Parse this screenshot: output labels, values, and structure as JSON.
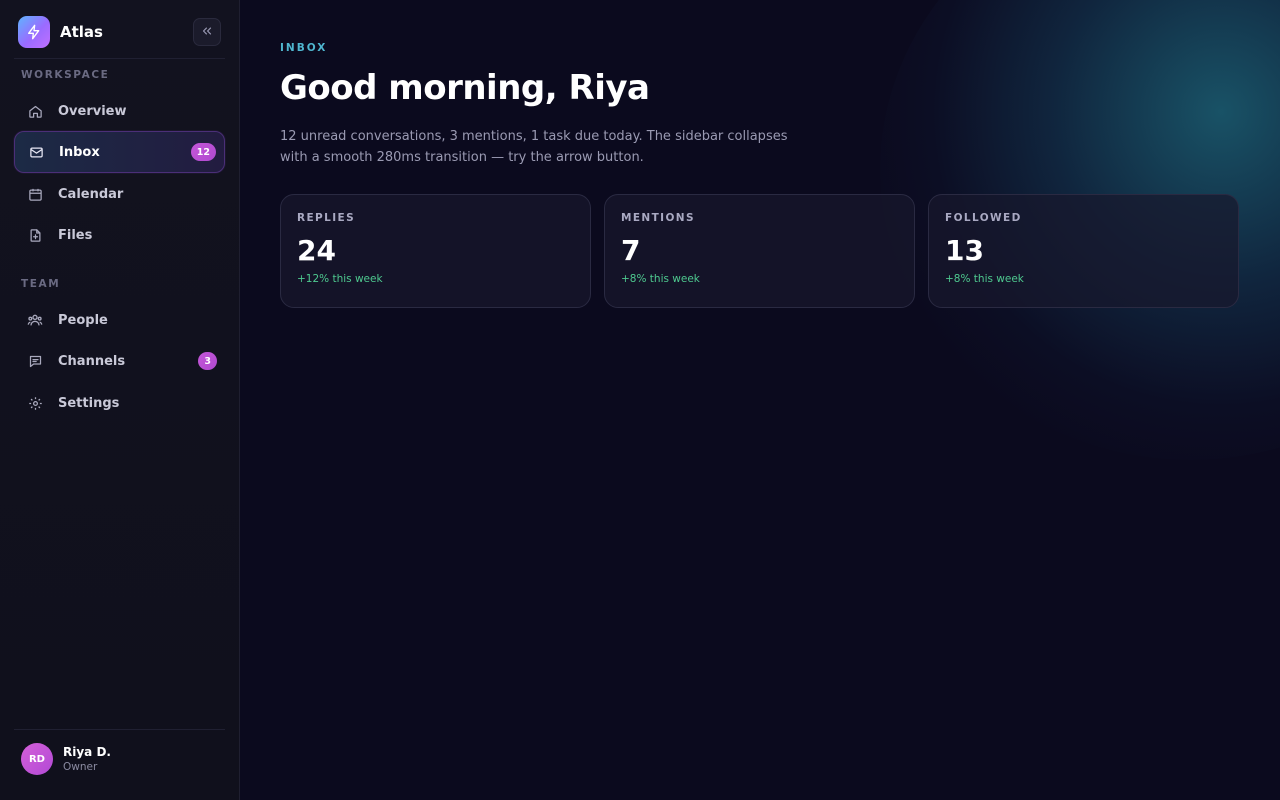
{
  "app": {
    "name": "Atlas"
  },
  "sidebar": {
    "sections": [
      {
        "label": "WORKSPACE"
      },
      {
        "label": "TEAM"
      }
    ],
    "items": [
      {
        "label": "Overview",
        "icon": "home-icon"
      },
      {
        "label": "Inbox",
        "icon": "mail-icon",
        "badge": "12",
        "active": true
      },
      {
        "label": "Calendar",
        "icon": "calendar-icon"
      },
      {
        "label": "Files",
        "icon": "file-plus-icon"
      },
      {
        "label": "People",
        "icon": "people-icon"
      },
      {
        "label": "Channels",
        "icon": "chat-icon",
        "badge": "3"
      },
      {
        "label": "Settings",
        "icon": "gear-icon"
      }
    ],
    "user": {
      "initials": "RD",
      "name": "Riya D.",
      "role": "Owner"
    }
  },
  "main": {
    "eyebrow": "INBOX",
    "title": "Good morning, Riya",
    "subtitle": "12 unread conversations, 3 mentions, 1 task due today. The sidebar collapses with a smooth 280ms transition — try the arrow button.",
    "cards": [
      {
        "label": "REPLIES",
        "value": "24",
        "delta": "+12% this week"
      },
      {
        "label": "MENTIONS",
        "value": "7",
        "delta": "+8% this week"
      },
      {
        "label": "FOLLOWED",
        "value": "13",
        "delta": "+8% this week"
      }
    ]
  },
  "colors": {
    "accent": "#4fb6cf",
    "badge": "#c456d8",
    "positive": "#4ec98f",
    "background": "#0b0a1e"
  }
}
